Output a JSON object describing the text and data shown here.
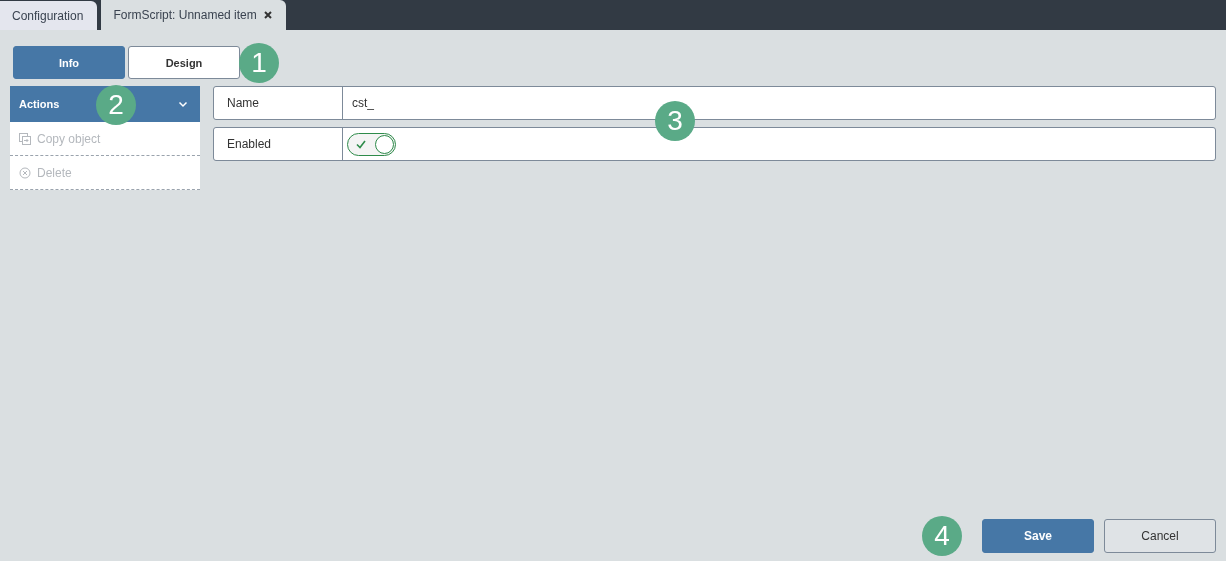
{
  "tabs": [
    {
      "label": "Configuration",
      "selected": false,
      "closable": false
    },
    {
      "label": "FormScript: Unnamed item",
      "selected": true,
      "closable": true
    }
  ],
  "view_buttons": [
    {
      "label": "Info",
      "selected": true
    },
    {
      "label": "Design",
      "selected": false
    }
  ],
  "actions": {
    "title": "Actions",
    "expanded": true,
    "items": [
      {
        "label": "Copy object",
        "kind": "copy",
        "disabled": true
      },
      {
        "label": "Delete",
        "kind": "delete",
        "disabled": true
      }
    ]
  },
  "fields": [
    {
      "label": "Name",
      "kind": "text",
      "value": "cst_"
    },
    {
      "label": "Enabled",
      "kind": "toggle",
      "on": true
    }
  ],
  "buttons": [
    {
      "label": "Save",
      "kind": "primary"
    },
    {
      "label": "Cancel",
      "kind": "secondary"
    }
  ],
  "callouts": [
    "1",
    "2",
    "3",
    "4"
  ]
}
